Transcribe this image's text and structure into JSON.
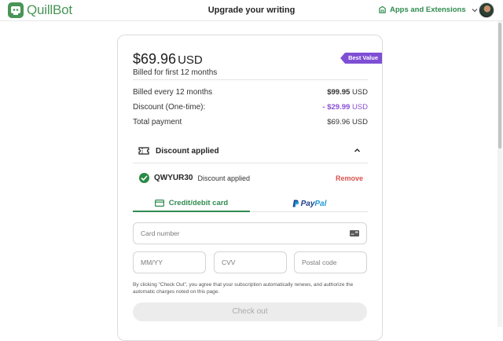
{
  "header": {
    "logo_text": "QuillBot",
    "title": "Upgrade your writing",
    "apps_label": "Apps and Extensions"
  },
  "plan": {
    "price": "$69.96",
    "currency": "USD",
    "billed_first": "Billed for first 12 months",
    "badge": "Best Value"
  },
  "summary": {
    "rows": [
      {
        "label": "Billed every 12 months",
        "amount": "$99.95",
        "unit": "USD"
      },
      {
        "label": "Discount (One-time):",
        "amount": "- $29.99",
        "unit": "USD"
      },
      {
        "label": "Total payment",
        "amount": "$69.96",
        "unit": "USD"
      }
    ]
  },
  "discount": {
    "header": "Discount applied",
    "code": "QWYUR30",
    "status": "Discount applied",
    "remove_label": "Remove"
  },
  "tabs": {
    "card_label": "Credit/debit card",
    "paypal_pay": "Pay",
    "paypal_pal": "Pal"
  },
  "form": {
    "card_number": "Card number",
    "expiry": "MM/YY",
    "cvv": "CVV",
    "postal": "Postal code"
  },
  "legal": "By clicking \"Check Out\", you agree that your subscription automatically renews, and authorize the automatic charges noted on this page.",
  "checkout_label": "Check out",
  "colors": {
    "brand_green": "#499557",
    "accent_green": "#2f8a4e",
    "badge_purple": "#7e4fd4",
    "discount_purple": "#8a4fd4",
    "remove_red": "#d9534f"
  }
}
